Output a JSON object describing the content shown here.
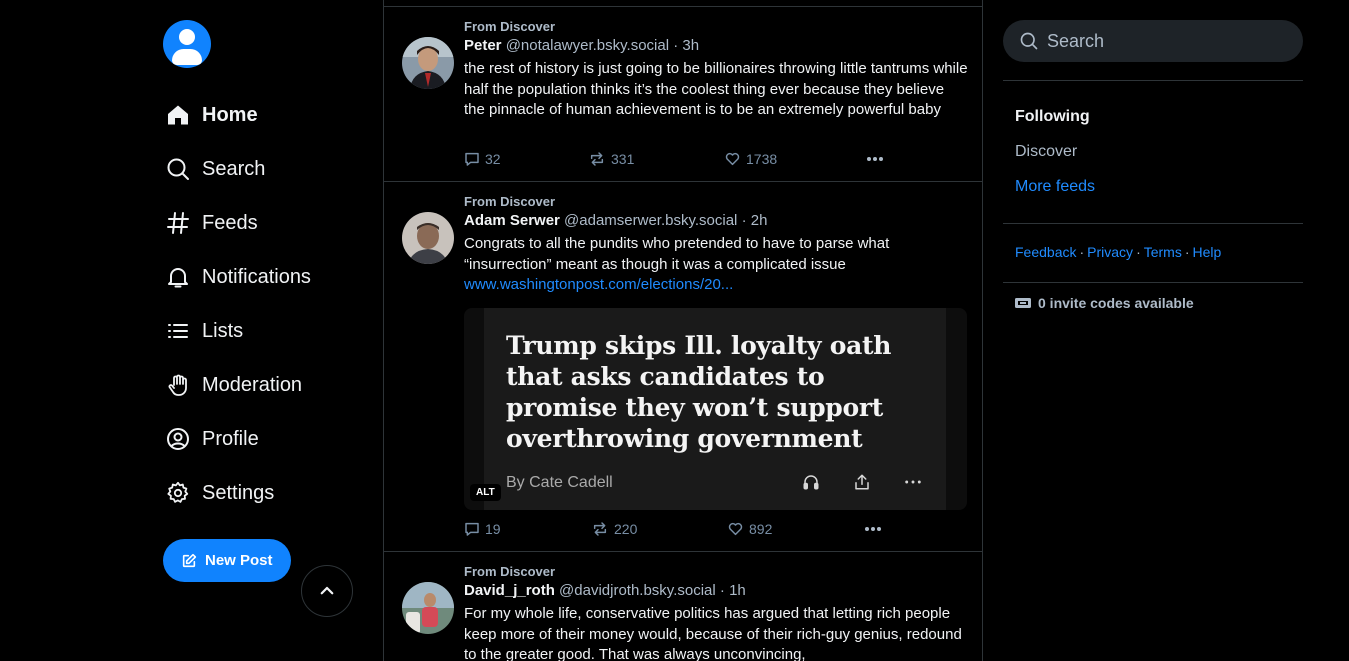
{
  "nav": {
    "items": [
      {
        "label": "Home",
        "icon": "home-icon"
      },
      {
        "label": "Search",
        "icon": "search-icon"
      },
      {
        "label": "Feeds",
        "icon": "hash-icon"
      },
      {
        "label": "Notifications",
        "icon": "bell-icon"
      },
      {
        "label": "Lists",
        "icon": "list-icon"
      },
      {
        "label": "Moderation",
        "icon": "hand-icon"
      },
      {
        "label": "Profile",
        "icon": "user-circle-icon"
      },
      {
        "label": "Settings",
        "icon": "gear-icon"
      }
    ],
    "new_post_label": "New Post"
  },
  "posts": [
    {
      "from": "From Discover",
      "name": "Peter",
      "handle": "@notalawyer.bsky.social",
      "time": "3h",
      "text": "the rest of history is just going to be billionaires throwing little tantrums while half the population thinks it’s the coolest thing ever because they believe the pinnacle of human achievement is to be an extremely powerful baby",
      "replies": "32",
      "reposts": "331",
      "likes": "1738"
    },
    {
      "from": "From Discover",
      "name": "Adam Serwer",
      "handle": "@adamserwer.bsky.social",
      "time": "2h",
      "text": "Congrats to all the pundits who pretended to have to parse what “insurrection” meant as though it was a complicated issue",
      "link": "www.washingtonpost.com/elections/20...",
      "embed": {
        "headline": "Trump skips Ill. loyalty oath that asks candidates to promise they won’t support overthrowing government",
        "byline": "By Cate Cadell",
        "alt": "ALT"
      },
      "replies": "19",
      "reposts": "220",
      "likes": "892"
    },
    {
      "from": "From Discover",
      "name": "David_j_roth",
      "handle": "@davidjroth.bsky.social",
      "time": "1h",
      "text": "For my whole life, conservative politics has argued that letting rich people keep more of their money would, because of their rich-guy genius, redound to the greater good. That was always unconvincing,"
    }
  ],
  "right": {
    "search_placeholder": "Search",
    "feeds": {
      "following": "Following",
      "discover": "Discover",
      "more": "More feeds"
    },
    "links": [
      "Feedback",
      "Privacy",
      "Terms",
      "Help"
    ],
    "link_separator": "·",
    "invites": "0 invite codes available"
  },
  "colors": {
    "accent": "#1083fe",
    "link": "#208bfe",
    "background": "#000000",
    "muted": "#788ea5"
  }
}
